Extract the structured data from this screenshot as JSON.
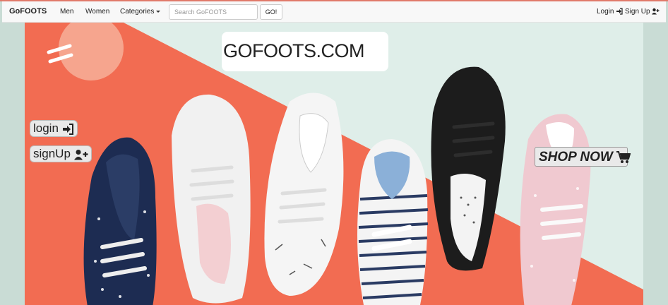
{
  "navbar": {
    "brand": "GoFOOTS",
    "links": [
      "Men",
      "Women"
    ],
    "categories_label": "Categories",
    "search_placeholder": "Search GoFOOTS",
    "go_label": "GO!",
    "login_label": "Login",
    "signup_label": "Sign Up"
  },
  "hero": {
    "logo": "GOFOOTS.COM",
    "login_label": "login",
    "signup_label": "signUp",
    "shop_label": "SHOP NOW"
  },
  "colors": {
    "orange": "#f26c52",
    "mint": "#dfeee9",
    "accent": "#e07a6a"
  }
}
